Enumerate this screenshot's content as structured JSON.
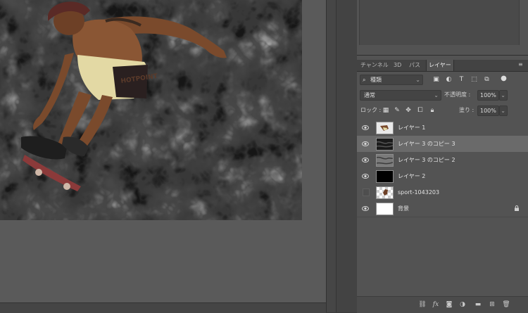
{
  "canvas": {
    "image_text": "HOTPOINT"
  },
  "layers_panel": {
    "tabs": [
      {
        "label": "チャンネル",
        "active": false
      },
      {
        "label": "3D",
        "active": false
      },
      {
        "label": "パス",
        "active": false
      },
      {
        "label": "レイヤー",
        "active": true
      }
    ],
    "filter": {
      "label": "種類"
    },
    "blend_mode": {
      "value": "通常"
    },
    "opacity": {
      "label": "不透明度 :",
      "value": "100%"
    },
    "lock": {
      "label": "ロック :"
    },
    "fill": {
      "label": "塗り :",
      "value": "100%"
    },
    "layers": [
      {
        "name": "レイヤー 1",
        "visible": true,
        "selected": false,
        "locked": false
      },
      {
        "name": "レイヤー 3 のコピー 3",
        "visible": true,
        "selected": true,
        "locked": false
      },
      {
        "name": "レイヤー 3 のコピー 2",
        "visible": true,
        "selected": false,
        "locked": false
      },
      {
        "name": "レイヤー 2",
        "visible": true,
        "selected": false,
        "locked": false
      },
      {
        "name": "sport-1043203",
        "visible": false,
        "selected": false,
        "locked": false
      },
      {
        "name": "背景",
        "visible": true,
        "selected": false,
        "locked": true
      }
    ],
    "bottom_icons": [
      "link-icon",
      "fx-icon",
      "mask-icon",
      "adjustment-icon",
      "folder-icon",
      "new-layer-icon",
      "trash-icon"
    ],
    "fx_label": "fx"
  },
  "colors": {
    "panel_bg": "#535353",
    "selected_row": "#6a6a6a",
    "canvas_bg": "#5a5a5a"
  }
}
